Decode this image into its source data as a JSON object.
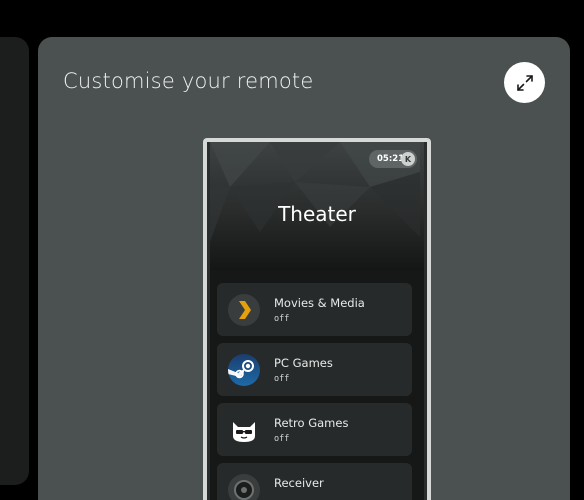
{
  "card": {
    "title": "Customise your remote",
    "expand_icon": "expand-arrows-icon"
  },
  "remote": {
    "status_time": "05:21",
    "avatar_initial": "K",
    "hero_title": "Theater",
    "activities": [
      {
        "name": "Movies & Media",
        "state": "off",
        "icon": "plex-chevron-icon"
      },
      {
        "name": "PC Games",
        "state": "off",
        "icon": "steam-icon"
      },
      {
        "name": "Retro Games",
        "state": "off",
        "icon": "cat-mascot-icon"
      },
      {
        "name": "Receiver",
        "state": "",
        "icon": "receiver-icon"
      }
    ]
  },
  "colors": {
    "page_background": "#000000",
    "card_background": "#4a5150",
    "phone_frame": "#d7d8d8",
    "activity_card": "#272a2a",
    "plex_accent": "#e5a00d",
    "steam_blue": "#1b3d6e"
  }
}
